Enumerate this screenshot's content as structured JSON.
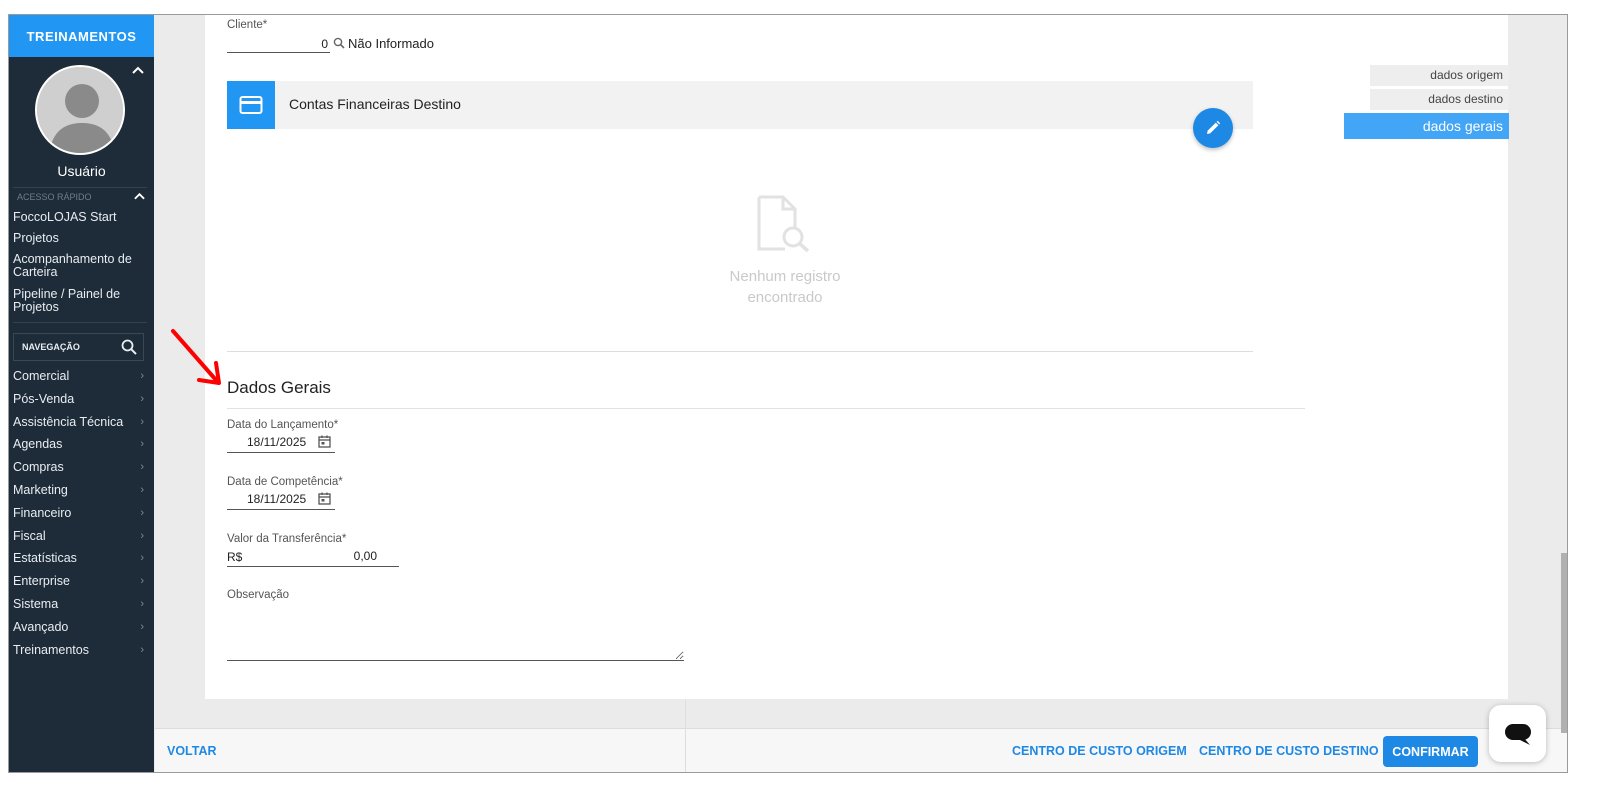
{
  "sidebar": {
    "brand": "TREINAMENTOS",
    "user_name": "Usuário",
    "quick_access_label": "ACESSO RÁPIDO",
    "quick_items": [
      "FoccoLOJAS Start",
      "Projetos",
      "Acompanhamento de Carteira",
      "Pipeline / Painel de Projetos"
    ],
    "nav_search_label": "NAVEGAÇÃO",
    "nav_items": [
      "Comercial",
      "Pós-Venda",
      "Assistência Técnica",
      "Agendas",
      "Compras",
      "Marketing",
      "Financeiro",
      "Fiscal",
      "Estatísticas",
      "Enterprise",
      "Sistema",
      "Avançado",
      "Treinamentos"
    ]
  },
  "form": {
    "cliente_label": "Cliente*",
    "cliente_value": "0",
    "cliente_name": "Não Informado",
    "contas_title": "Contas Financeiras Destino",
    "empty_text": "Nenhum registro encontrado",
    "section_title": "Dados Gerais",
    "data_lancamento_label": "Data do Lançamento*",
    "data_lancamento_value": "18/11/2025",
    "data_competencia_label": "Data de Competência*",
    "data_competencia_value": "18/11/2025",
    "valor_label": "Valor da Transferência*",
    "valor_currency": "R$",
    "valor_value": "0,00",
    "observacao_label": "Observação"
  },
  "side_tabs": {
    "origem": "dados origem",
    "destino": "dados destino",
    "gerais": "dados gerais"
  },
  "footer": {
    "voltar": "VOLTAR",
    "centro_origem": "CENTRO DE CUSTO ORIGEM",
    "centro_destino": "CENTRO DE CUSTO DESTINO",
    "confirmar": "CONFIRMAR"
  },
  "colors": {
    "accent": "#2196f3",
    "sidebar_bg": "#1e2b38",
    "annotation_red": "#ff0000"
  }
}
